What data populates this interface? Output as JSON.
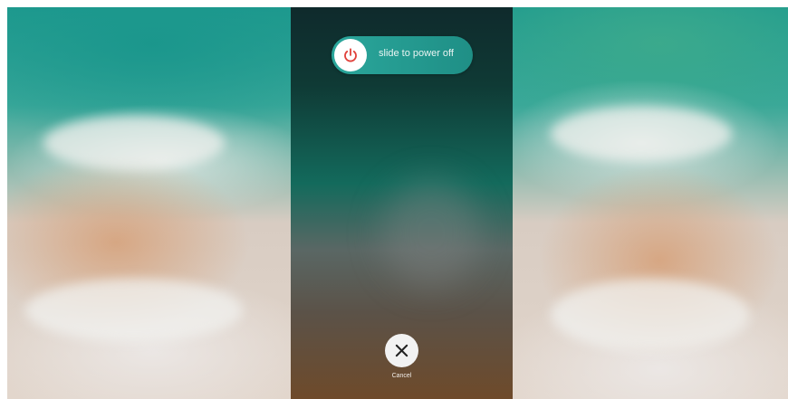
{
  "power_off_screen": {
    "slider_label": "slide to power off",
    "power_icon": "power-icon",
    "cancel_icon": "close-icon",
    "cancel_label": "Cancel"
  },
  "colors": {
    "power_icon": "#e0403a",
    "slider_track": "#2aa69b",
    "cancel_button": "#f2f2f2",
    "cancel_glyph": "#222222"
  }
}
